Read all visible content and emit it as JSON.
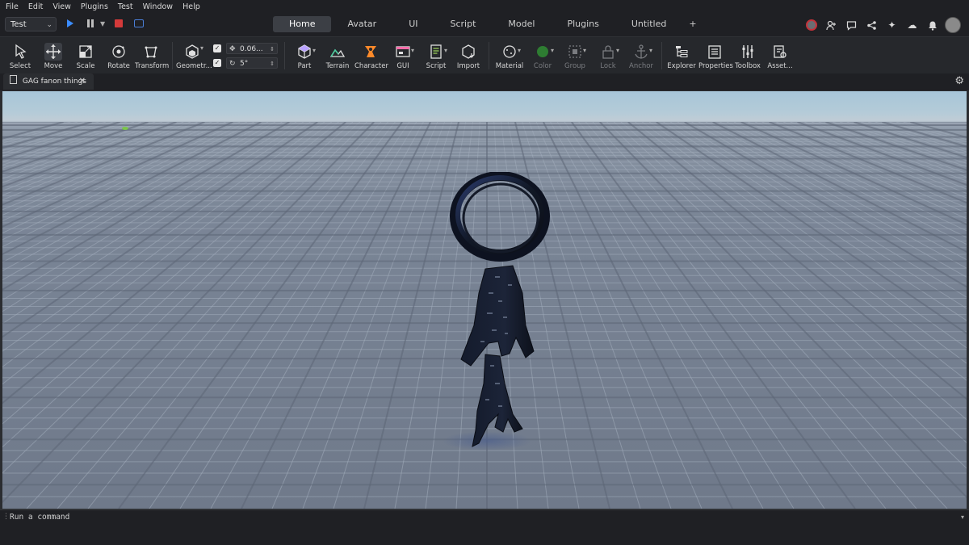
{
  "menubar": {
    "items": [
      "File",
      "Edit",
      "View",
      "Plugins",
      "Test",
      "Window",
      "Help"
    ]
  },
  "topbar": {
    "mode_select": "Test",
    "tabs": [
      "Home",
      "Avatar",
      "UI",
      "Script",
      "Model",
      "Plugins",
      "Untitled",
      "+"
    ],
    "active_tab": "Home"
  },
  "ribbon": {
    "tools": {
      "select": "Select",
      "move": "Move",
      "scale": "Scale",
      "rotate": "Rotate",
      "transform": "Transform",
      "geometry": "Geometr...",
      "part": "Part",
      "terrain": "Terrain",
      "character": "Character",
      "gui": "GUI",
      "script": "Script",
      "import": "Import",
      "material": "Material",
      "color": "Color",
      "group": "Group",
      "lock": "Lock",
      "anchor": "Anchor",
      "explorer": "Explorer",
      "properties": "Properties",
      "toolbox": "Toolbox",
      "assets": "Asset..."
    },
    "move_increment": "0.06...",
    "rotate_increment": "5°"
  },
  "document": {
    "tab_title": "GAG fanon things"
  },
  "console": {
    "placeholder": "Run a command"
  },
  "colors": {
    "accent": "#3b8cff",
    "stop": "#d43a3a",
    "record": "#c4323a",
    "color_swatch": "#2e7d32"
  }
}
